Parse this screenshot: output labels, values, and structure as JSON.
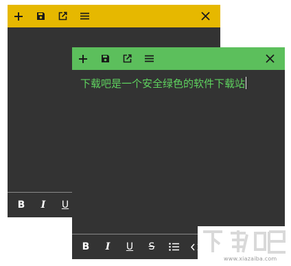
{
  "back_note": {
    "header_color": "#e6b800",
    "toolbar": {
      "new_icon": "plus-icon",
      "save_icon": "save-icon",
      "open_icon": "open-external-icon",
      "menu_icon": "menu-icon",
      "close_icon": "close-icon"
    },
    "format": {
      "bold_label": "B",
      "italic_label": "I",
      "underline_label": "U"
    }
  },
  "front_note": {
    "header_color": "#5cbf5c",
    "text": "下载吧是一个安全绿色的软件下载站",
    "text_color": "#5fd35f",
    "toolbar": {
      "new_icon": "plus-icon",
      "save_icon": "save-icon",
      "open_icon": "open-external-icon",
      "menu_icon": "menu-icon",
      "close_icon": "close-icon"
    },
    "format": {
      "bold_label": "B",
      "italic_label": "I",
      "underline_label": "U",
      "strike_label": "S",
      "list_icon": "bullet-list-icon",
      "code_icon": "code-icon"
    }
  },
  "watermark": {
    "logo": "下载吧",
    "url": "www.xiazaiba.com"
  }
}
